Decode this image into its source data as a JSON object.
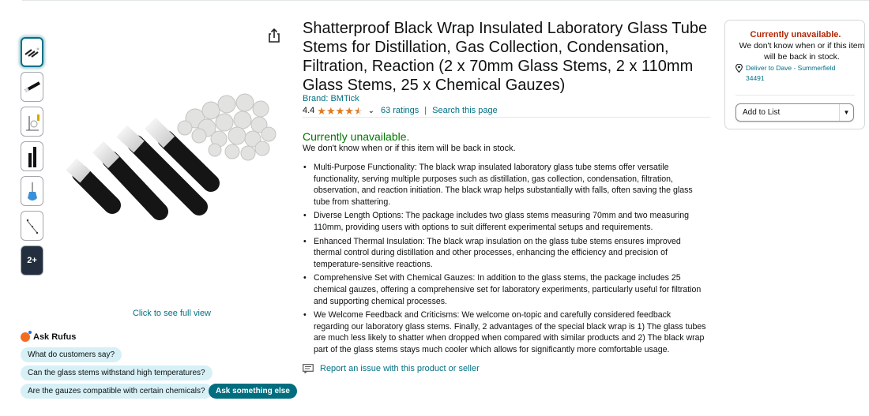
{
  "product": {
    "title": "Shatterproof Black Wrap Insulated Laboratory Glass Tube Stems for Distillation, Gas Collection, Condensation, Filtration, Reaction (2 x 70mm Glass Stems, 2 x 110mm Glass Stems, 25 x Chemical Gauzes)",
    "brand": "Brand: BMTick",
    "rating": "4.4",
    "stars": 4.4,
    "ratings_count": "63 ratings",
    "search_link": "Search this page"
  },
  "availability": {
    "headline": "Currently unavailable.",
    "detail": "We don't know when or if this item will be back in stock."
  },
  "bullets": [
    "Multi-Purpose Functionality: The black wrap insulated laboratory glass tube stems offer versatile functionality, serving multiple purposes such as distillation, gas collection, condensation, filtration, observation, and reaction initiation. The black wrap helps substantially with falls, often saving the glass tube from shattering.",
    "Diverse Length Options: The package includes two glass stems measuring 70mm and two measuring 110mm, providing users with options to suit different experimental setups and requirements.",
    "Enhanced Thermal Insulation: The black wrap insulation on the glass tube stems ensures improved thermal control during distillation and other processes, enhancing the efficiency and precision of temperature-sensitive reactions.",
    "Comprehensive Set with Chemical Gauzes: In addition to the glass stems, the package includes 25 chemical gauzes, offering a comprehensive set for laboratory experiments, particularly useful for filtration and supporting chemical processes.",
    "We Welcome Feedback and Criticisms: We welcome on-topic and carefully considered feedback regarding our laboratory glass stems. Finally, 2 advantages of the special black wrap is 1) The glass tubes are much less likely to shatter when dropped when compared with similar products and 2) The black wrap part of the glass stems stays much cooler which allows for significantly more comfortable usage."
  ],
  "report_link": "Report an issue with this product or seller",
  "gallery": {
    "more_label": "2+",
    "full_view": "Click to see full view"
  },
  "rufus": {
    "title": "Ask Rufus",
    "chips": [
      "What do customers say?",
      "Can the glass stems withstand high temperatures?",
      "Are the gauzes compatible with certain chemicals?"
    ],
    "ask_button": "Ask something else"
  },
  "buybox": {
    "headline": "Currently unavailable.",
    "detail": "We don't know when or if this item will be back in stock.",
    "deliver_to": "Deliver to Dave - Summerfield 34491",
    "add_to_list": "Add to List"
  },
  "colors": {
    "link": "#007185",
    "unavailable_green": "#007600",
    "unavailable_red": "#b12704",
    "star": "#de7921",
    "chip_bg": "#d6f0f6",
    "chip_dark": "#006e7f"
  },
  "icons": [
    "share-icon",
    "chevron-down-icon",
    "location-pin-icon",
    "report-flag-icon",
    "rufus-icon"
  ]
}
